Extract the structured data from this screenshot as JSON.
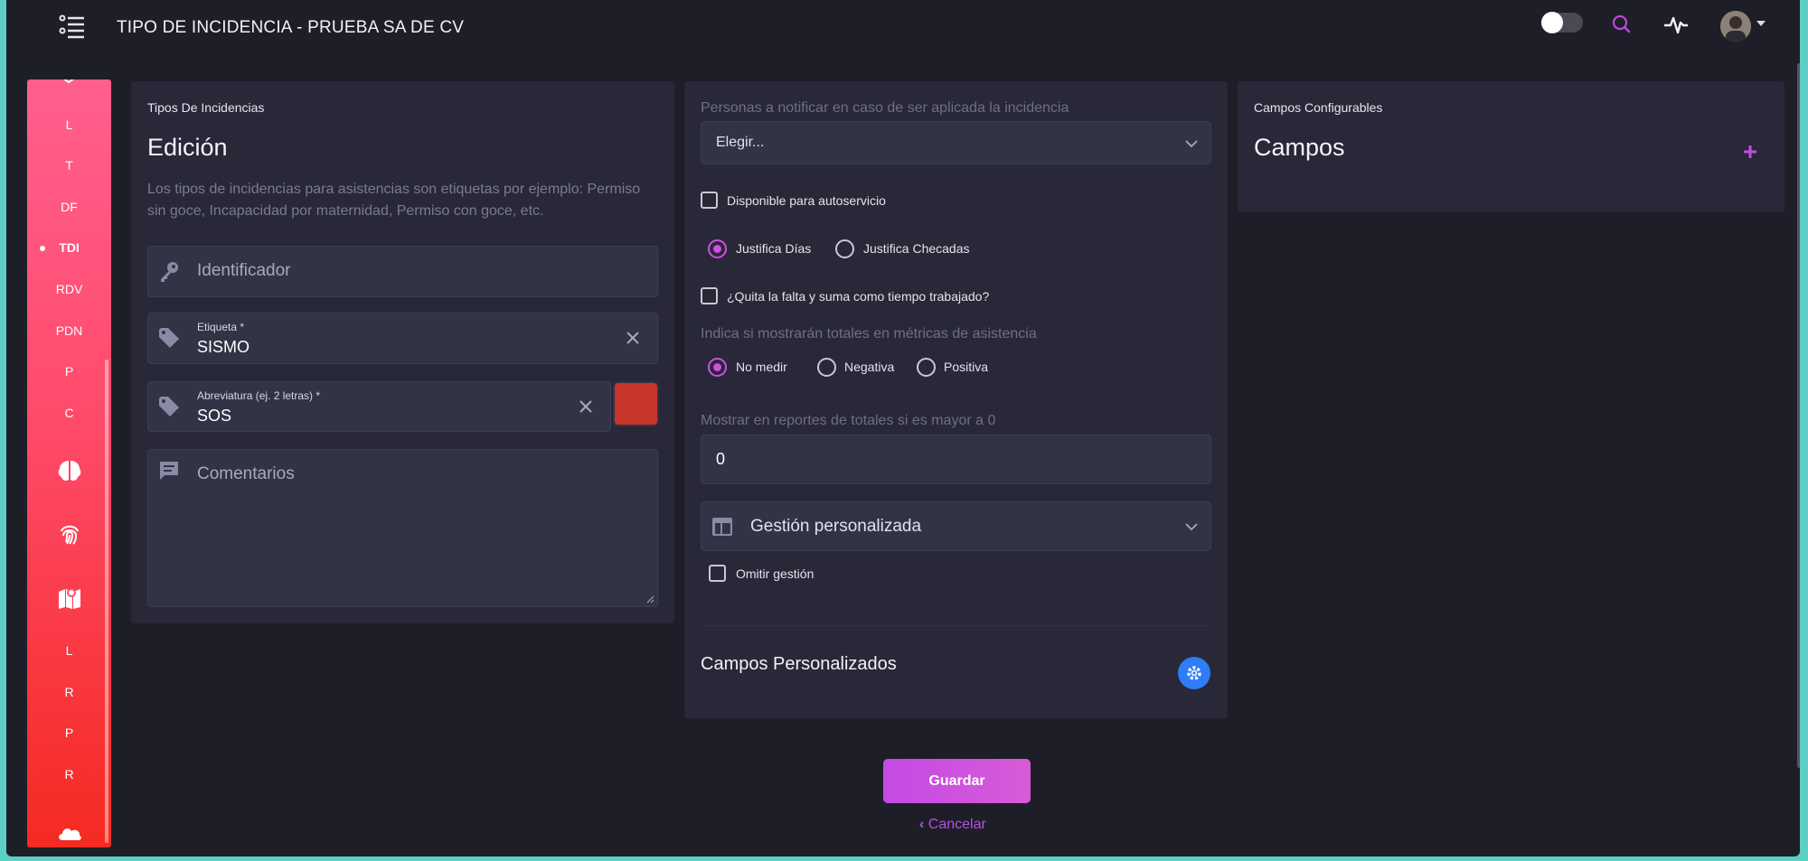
{
  "header": {
    "title": "TIPO DE INCIDENCIA - PRUEBA SA DE CV"
  },
  "sidebar": {
    "items": [
      {
        "label": "L"
      },
      {
        "label": "T"
      },
      {
        "label": "DF"
      },
      {
        "label": "TDI",
        "active": true
      },
      {
        "label": "RDV"
      },
      {
        "label": "PDN"
      },
      {
        "label": "P"
      },
      {
        "label": "C"
      },
      {
        "label": "L"
      },
      {
        "label": "R"
      },
      {
        "label": "P"
      },
      {
        "label": "R"
      }
    ],
    "icons": [
      "brain-icon",
      "fingerprint-icon",
      "map-icon",
      "cloud-icon"
    ]
  },
  "edit_card": {
    "subtitle": "Tipos De Incidencias",
    "title": "Edición",
    "description": "Los tipos de incidencias para asistencias son etiquetas por ejemplo: Permiso sin goce, Incapacidad por maternidad, Permiso con goce, etc.",
    "identifier_placeholder": "Identificador",
    "label_field": {
      "label": "Etiqueta *",
      "value": "SISMO"
    },
    "abbr_field": {
      "label": "Abreviatura (ej. 2 letras) *",
      "value": "SOS"
    },
    "color": "#c8352a",
    "comments_placeholder": "Comentarios"
  },
  "config_card": {
    "notify_label": "Personas a notificar en caso de ser aplicada la incidencia",
    "notify_select": "Elegir...",
    "self_service_label": "Disponible para autoservicio",
    "justify_days_label": "Justifica Días",
    "justify_checks_label": "Justifica Checadas",
    "remove_absence_label": "¿Quita la falta y suma como tiempo trabajado?",
    "metrics_label": "Indica si mostrarán totales en métricas de asistencia",
    "metrics_options": [
      "No medir",
      "Negativa",
      "Positiva"
    ],
    "metrics_selected": "No medir",
    "reports_label": "Mostrar en reportes de totales si es mayor a 0",
    "reports_value": "0",
    "custom_mgmt_label": "Gestión personalizada",
    "omit_mgmt_label": "Omitir gestión",
    "custom_fields_title": "Campos Personalizados"
  },
  "fields_card": {
    "subtitle": "Campos Configurables",
    "title": "Campos"
  },
  "actions": {
    "save": "Guardar",
    "cancel": "Cancelar"
  },
  "colors": {
    "accent": "#d14fe2",
    "background": "#1e1e28",
    "card": "#282838",
    "gear_button": "#2e7cf6"
  }
}
